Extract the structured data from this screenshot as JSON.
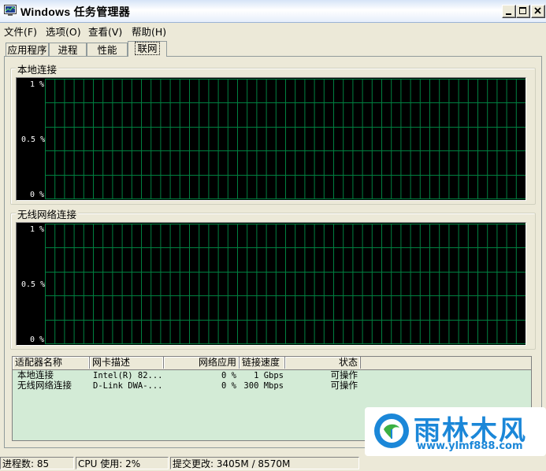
{
  "window": {
    "title": "Windows 任务管理器"
  },
  "menu": [
    {
      "label": "文件(F)"
    },
    {
      "label": "选项(O)"
    },
    {
      "label": "查看(V)"
    },
    {
      "label": "帮助(H)"
    }
  ],
  "tabs": [
    {
      "label": "应用程序"
    },
    {
      "label": "进程"
    },
    {
      "label": "性能"
    },
    {
      "label": "联网",
      "active": true
    }
  ],
  "graphs": [
    {
      "title": "本地连接",
      "ticks": [
        "1 %",
        "0.5 %",
        "0 %"
      ]
    },
    {
      "title": "无线网络连接",
      "ticks": [
        "1 %",
        "0.5 %",
        "0 %"
      ]
    }
  ],
  "adapters": {
    "columns": [
      "适配器名称",
      "网卡描述",
      "网络应用",
      "链接速度",
      "状态"
    ],
    "rows": [
      [
        "本地连接",
        "Intel(R) 82...",
        "0 %",
        "1 Gbps",
        "可操作"
      ],
      [
        "无线网络连接",
        "D-Link DWA-...",
        "0 %",
        "300 Mbps",
        "可操作"
      ]
    ]
  },
  "status": {
    "processes": "进程数: 85",
    "cpu": "CPU 使用: 2%",
    "commit": "提交更改: 3405M / 8570M"
  },
  "watermark": {
    "name": "雨林木风",
    "url": "www.ylmf888.com"
  },
  "colors": {
    "graph_bg": "#000000",
    "grid": "#008040",
    "list_bg": "#d3ebd6",
    "brand": "#1b87d8"
  }
}
